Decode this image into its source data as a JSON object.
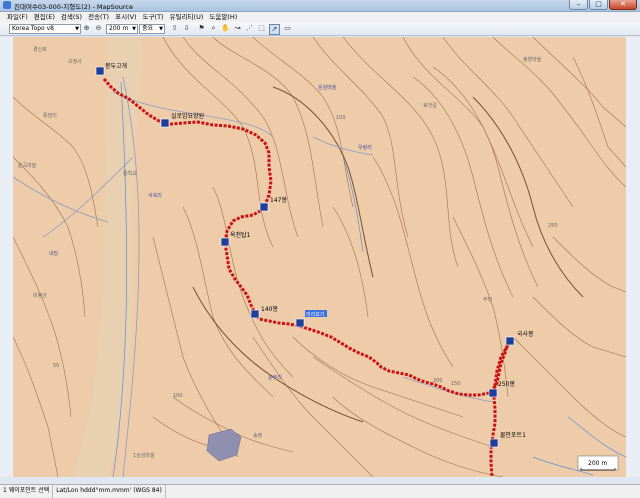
{
  "window": {
    "title": "진대여수03-000-지형도(2) - MapSource"
  },
  "menu": [
    "파일(F)",
    "편집(E)",
    "검색(S)",
    "전송(T)",
    "표시(V)",
    "도구(T)",
    "유틸리티(U)",
    "도움말(H)"
  ],
  "toolbar": {
    "map_product": "Korea Topo v8",
    "zoom_level": "200 m",
    "detail": "중요"
  },
  "waypoints": [
    {
      "id": "w1",
      "label": "봉두고개"
    },
    {
      "id": "w2",
      "label": "실로암요양원"
    },
    {
      "id": "w3",
      "label": "147봉"
    },
    {
      "id": "w4",
      "label": "옥천탑1"
    },
    {
      "id": "w5",
      "label": "140봉"
    },
    {
      "id": "w6",
      "label": "미리보기"
    },
    {
      "id": "w7",
      "label": "국사봉"
    },
    {
      "id": "w8",
      "label": "250봉"
    },
    {
      "id": "w9",
      "label": "물안포트1"
    }
  ],
  "map_labels": [
    "경신로",
    "오정사",
    "운암마을",
    "풍암리",
    "원곡마을",
    "서북리",
    "내당",
    "우렁리",
    "통학교",
    "봉양마을",
    "효천길",
    "무당",
    "운부리",
    "송정",
    "비봉산",
    "1상성마을"
  ],
  "contour_numbers": [
    "100",
    "200",
    "150",
    "250",
    "100",
    "50"
  ],
  "scale_bar": {
    "label": "200 m"
  },
  "status": {
    "selection": "1 웨이포인트 선택",
    "format": "Lat/Lon hddd°mm.mmm' (WGS 84)"
  },
  "colors": {
    "track": "#cc1111",
    "land": "#eeccaa",
    "contour": "#a07050",
    "water": "#5b8ed8",
    "waypoint": "#1e3f9c"
  }
}
